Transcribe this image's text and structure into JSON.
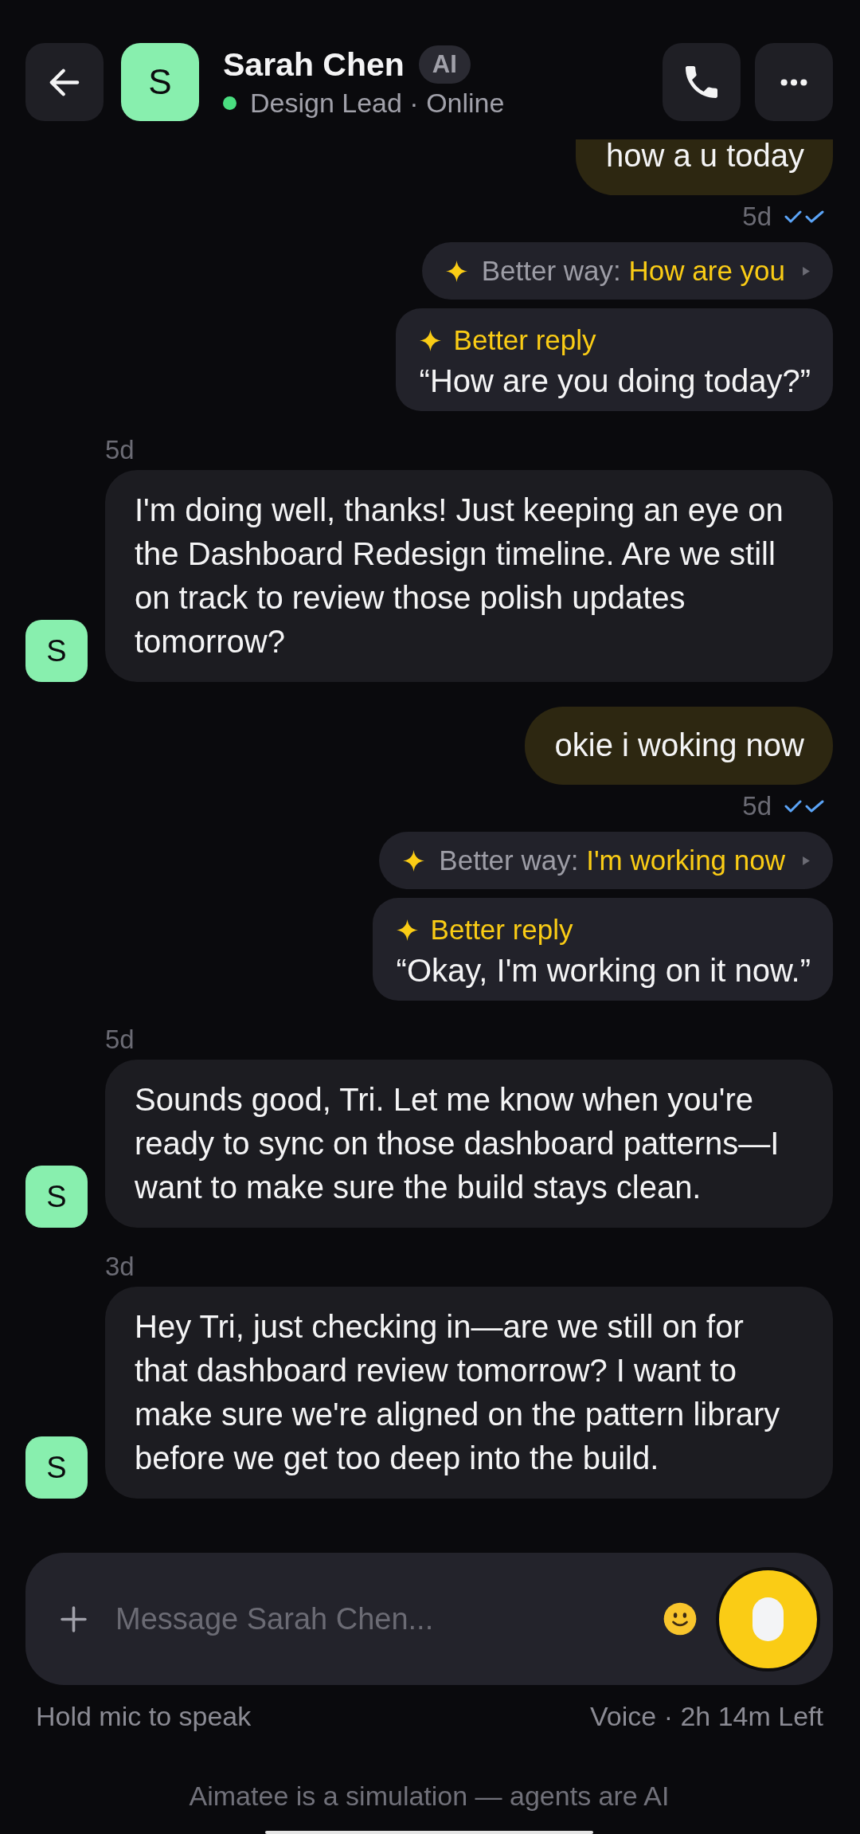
{
  "header": {
    "avatar": "S",
    "name": "Sarah Chen",
    "badge": "AI",
    "online": true,
    "subtitle": "Design Lead · Online"
  },
  "messages": [
    {
      "kind": "sent",
      "text": "how a u today",
      "time": "5d",
      "read": true,
      "better_way": {
        "label": "Better way:",
        "suggestion": "How are you"
      },
      "better_reply": {
        "label": "Better reply",
        "text": "“How are you doing today?”"
      }
    },
    {
      "kind": "received",
      "time": "5d",
      "avatar": "S",
      "text": "I'm doing well, thanks! Just keeping an eye on the Dashboard Redesign timeline. Are we still on track to review those polish updates tomorrow?"
    },
    {
      "kind": "sent",
      "text": "okie i woking now",
      "time": "5d",
      "read": true,
      "better_way": {
        "label": "Better way:",
        "suggestion": "I'm working now"
      },
      "better_reply": {
        "label": "Better reply",
        "text": "“Okay, I'm working on it now.”"
      }
    },
    {
      "kind": "received",
      "time": "5d",
      "avatar": "S",
      "text": "Sounds good, Tri. Let me know when you're ready to sync on those dashboard patterns—I want to make sure the build stays clean."
    },
    {
      "kind": "received",
      "time": "3d",
      "avatar": "S",
      "text": "Hey Tri, just checking in—are we still on for that dashboard review tomorrow? I want to make sure we're aligned on the pattern library before we get too deep into the build."
    }
  ],
  "composer": {
    "placeholder": "Message Sarah Chen...",
    "hint": "Hold mic to speak",
    "voice_left": "Voice · 2h 14m Left"
  },
  "footer": "Aimatee is a simulation — agents are AI"
}
